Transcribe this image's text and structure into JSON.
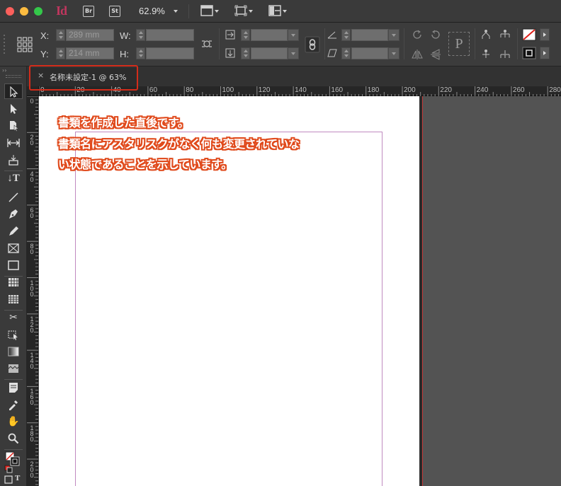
{
  "titlebar": {
    "app_logo": "Id",
    "bridge_badge": "Br",
    "stock_badge": "St",
    "zoom_level": "62.9%",
    "icons": [
      "view-options-icon",
      "screen-mode-icon",
      "arrange-documents-icon"
    ]
  },
  "control_panel": {
    "x_label": "X:",
    "x_value": "289 mm",
    "y_label": "Y:",
    "y_value": "214 mm",
    "w_label": "W:",
    "w_value": "",
    "h_label": "H:",
    "h_value": "",
    "icons": [
      "reference-point-icon",
      "constrain-proportions-icon",
      "scale-x-icon",
      "scale-y-icon",
      "link-icon",
      "rotate-icon",
      "shear-icon",
      "rotate-cw-icon",
      "rotate-ccw-icon",
      "flip-horizontal-icon",
      "flip-vertical-icon",
      "paragraph-icon",
      "select-container-icon",
      "select-content-icon",
      "fill-swatch-icon",
      "stroke-swatch-icon"
    ]
  },
  "document_tab": {
    "close_glyph": "×",
    "label": "名称未設定-1 @ 63%"
  },
  "horizontal_ruler": {
    "ticks": [
      "0",
      "20",
      "40",
      "60",
      "80",
      "100",
      "120",
      "140",
      "160",
      "180",
      "200",
      "220",
      "240",
      "260",
      "280"
    ]
  },
  "vertical_ruler": {
    "ticks": [
      "0",
      "2\n0",
      "4\n0",
      "6\n0",
      "8\n0",
      "1\n0\n0",
      "1\n2\n0",
      "1\n4\n0",
      "1\n6\n0",
      "1\n8\n0",
      "2\n0\n0"
    ]
  },
  "annotation": {
    "line1": "書類を作成した直後です。",
    "line2": "書類名にアスタリスクがなく何も変更されていな",
    "line3": "い状態であることを示しています。"
  },
  "colors": {
    "highlight_border": "#d42c1a",
    "annotation_outline": "#e04a1c",
    "margin_guide": "#c08ac0",
    "bleed_guide": "#c23a3a",
    "app_accent": "#c0365e"
  }
}
